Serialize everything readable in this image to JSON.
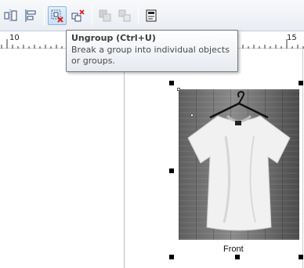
{
  "toolbar": {
    "buttons": [
      {
        "name": "align-distribute-icon",
        "state": "normal"
      },
      {
        "name": "object-properties-icon",
        "state": "normal"
      },
      {
        "name": "ungroup-icon",
        "state": "active"
      },
      {
        "name": "ungroup-all-icon",
        "state": "normal"
      },
      {
        "name": "combine-icon",
        "state": "disabled"
      },
      {
        "name": "break-apart-icon",
        "state": "disabled"
      },
      {
        "name": "lock-object-icon",
        "state": "normal"
      }
    ]
  },
  "ruler": {
    "labels": [
      "10",
      "15"
    ]
  },
  "tooltip": {
    "title": "Ungroup (Ctrl+U)",
    "description": "Break a group into individual objects or groups."
  },
  "canvas": {
    "caption": "Front"
  },
  "colors": {
    "toolbar_bg": "#eef1f5",
    "active_button": "#c9e0f5",
    "ungroup_accent": "#d9231d",
    "tshirt": "#f2f2f2",
    "wall": "#6e6e6e"
  }
}
